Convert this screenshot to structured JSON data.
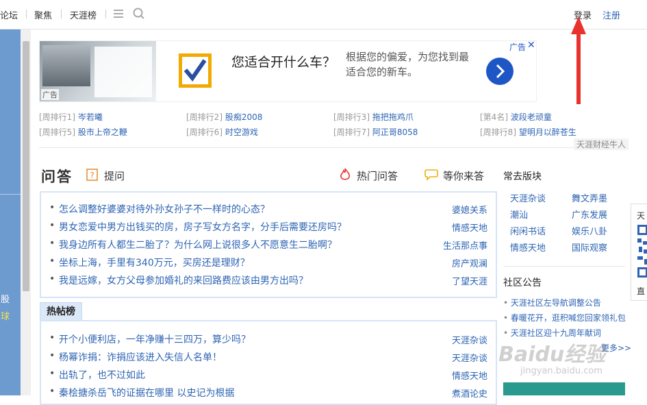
{
  "topbar": {
    "nav": [
      "论坛",
      "聚焦",
      "天涯榜"
    ],
    "login": "登录",
    "register": "注册"
  },
  "leftstrip": {
    "chars": [
      "股",
      "球"
    ]
  },
  "ad": {
    "title": "您适合开什么车？",
    "desc": "根据您的偏爱，为您找到最适合您的新车。",
    "tag": "广告",
    "img_label": "广告"
  },
  "rankings": [
    {
      "label": "[周排行1]",
      "name": "岑若曦"
    },
    {
      "label": "[周排行2]",
      "name": "股痴2008"
    },
    {
      "label": "[周排行3]",
      "name": "拖把拖鸡爪"
    },
    {
      "label": "[第4名]",
      "name": "波段老顽童"
    },
    {
      "label": "[周排行5]",
      "name": "股市上帝之鞭"
    },
    {
      "label": "[周排行6]",
      "name": "时空游戏"
    },
    {
      "label": "[周排行7]",
      "name": "阿正哥8058"
    },
    {
      "label": "[周排行8]",
      "name": "望明月以醉苍生"
    }
  ],
  "ranking_footer": "天涯财经牛人",
  "qa": {
    "logo": "问答",
    "ask": "提问",
    "hot": "热门问答",
    "waiting": "等你来答",
    "items": [
      {
        "q": "怎么调整好婆婆对待外孙女孙子不一样时的心态？",
        "cat": "婆媳关系"
      },
      {
        "q": "男女恋爱中男方出钱买的房，房子写女方名字，分手后需要还房吗？",
        "cat": "情感天地"
      },
      {
        "q": "我身边所有人都生二胎了？为什么网上说很多人不愿意生二胎啊？",
        "cat": "生活那点事"
      },
      {
        "q": "坐标上海，手里有340万元，买房还是理财？",
        "cat": "房产观澜"
      },
      {
        "q": "我是远嫁，女方父母参加婚礼的来回路费应该由男方出吗？",
        "cat": "了望天涯"
      }
    ]
  },
  "hot": {
    "tab": "热帖榜",
    "items": [
      {
        "q": "开个小便利店，一年净赚十三四万，算少吗？",
        "cat": "天涯杂谈"
      },
      {
        "q": "杨幂诈捐：诈捐应该进入失信人名单！",
        "cat": "天涯杂谈"
      },
      {
        "q": "出轨了，也不过如此",
        "cat": "情感天地"
      },
      {
        "q": "秦桧搪杀岳飞的证据在哪里 以史记为根据",
        "cat": "煮酒论史"
      }
    ]
  },
  "side": {
    "boards_title": "常去版块",
    "boards": [
      "天涯杂谈",
      "舞文弄墨",
      "潮汕",
      "广东发展",
      "闲闲书话",
      "娱乐八卦",
      "情感天地",
      "国际观察"
    ],
    "notice_title": "社区公告",
    "notices": [
      "天涯社区左导航调整公告",
      "春暖花开，逛积喊您回家领礼包",
      "天涯社区迎十九周年献词"
    ],
    "more": "更多>>"
  },
  "qr": {
    "label": "天",
    "label2": "直"
  },
  "watermark": {
    "main": "Baidu经验",
    "sub": "jingyan.baidu.com"
  },
  "colors": {
    "link": "#2d64b3",
    "strip": "#6d9bd0",
    "qa_border": "#d4e4f7",
    "arrow": "#e8322d"
  }
}
